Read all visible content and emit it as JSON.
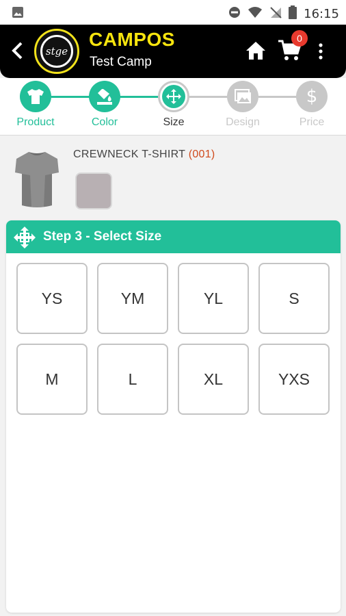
{
  "status_bar": {
    "time": "16:15"
  },
  "header": {
    "title": "CAMPOS",
    "subtitle": "Test Camp",
    "logo_text": "stge",
    "cart_count": "0"
  },
  "stepper": {
    "steps": [
      {
        "label": "Product",
        "state": "done",
        "icon": "tshirt-icon"
      },
      {
        "label": "Color",
        "state": "done",
        "icon": "paint-bucket-icon"
      },
      {
        "label": "Size",
        "state": "current",
        "icon": "move-arrows-icon"
      },
      {
        "label": "Design",
        "state": "todo",
        "icon": "image-icon"
      },
      {
        "label": "Price",
        "state": "todo",
        "icon": "dollar-icon"
      }
    ]
  },
  "product": {
    "name": "CREWNECK T-SHIRT",
    "code": "(001)",
    "swatch_color": "#b8b0b3"
  },
  "section": {
    "title": "Step 3 - Select Size"
  },
  "sizes": [
    "YS",
    "YM",
    "YL",
    "S",
    "M",
    "L",
    "XL",
    "YXS"
  ],
  "colors": {
    "accent": "#22bf99",
    "brand_yellow": "#f6e40e",
    "badge_red": "#e83a2e",
    "code_red": "#d04a1c"
  }
}
